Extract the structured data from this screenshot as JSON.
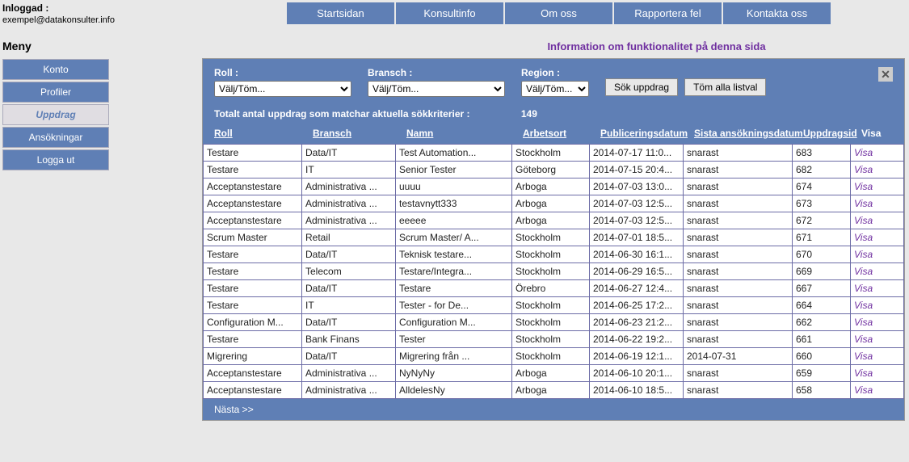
{
  "topNav": [
    "Startsidan",
    "Konsultinfo",
    "Om oss",
    "Rapportera fel",
    "Kontakta oss"
  ],
  "infoLink": "Information om funktionalitet på denna sida",
  "login": {
    "label": "Inloggad :",
    "email": "exempel@datakonsulter.info"
  },
  "menyLabel": "Meny",
  "sideMenu": [
    "Konto",
    "Profiler",
    "Uppdrag",
    "Ansökningar",
    "Logga ut"
  ],
  "sideMenuActive": 2,
  "filters": {
    "roll": {
      "label": "Roll :",
      "value": "Välj/Töm..."
    },
    "bransch": {
      "label": "Bransch :",
      "value": "Välj/Töm..."
    },
    "region": {
      "label": "Region :",
      "value": "Välj/Töm..."
    },
    "searchBtn": "Sök uppdrag",
    "clearBtn": "Töm alla listval"
  },
  "summary": {
    "label": "Totalt antal uppdrag som matchar aktuella sökkriterier :",
    "count": "149"
  },
  "headers": {
    "roll": "Roll",
    "bransch": "Bransch",
    "namn": "Namn",
    "arbetsort": "Arbetsort",
    "pub": "Publiceringsdatum",
    "sista": "Sista ansökningsdatum",
    "id": "Uppdragsid",
    "visa": "Visa"
  },
  "rows": [
    {
      "roll": "Testare",
      "bransch": "Data/IT",
      "namn": "Test Automation...",
      "arbetsort": "Stockholm",
      "pub": "2014-07-17 11:0...",
      "sista": "snarast",
      "id": "683",
      "visa": "Visa"
    },
    {
      "roll": "Testare",
      "bransch": "IT",
      "namn": "Senior Tester",
      "arbetsort": "Göteborg",
      "pub": "2014-07-15 20:4...",
      "sista": "snarast",
      "id": "682",
      "visa": "Visa"
    },
    {
      "roll": "Acceptanstestare",
      "bransch": "Administrativa ...",
      "namn": "uuuu",
      "arbetsort": "Arboga",
      "pub": "2014-07-03 13:0...",
      "sista": "snarast",
      "id": "674",
      "visa": "Visa"
    },
    {
      "roll": "Acceptanstestare",
      "bransch": "Administrativa ...",
      "namn": "testavnytt333",
      "arbetsort": "Arboga",
      "pub": "2014-07-03 12:5...",
      "sista": "snarast",
      "id": "673",
      "visa": "Visa"
    },
    {
      "roll": "Acceptanstestare",
      "bransch": "Administrativa ...",
      "namn": "eeeee",
      "arbetsort": "Arboga",
      "pub": "2014-07-03 12:5...",
      "sista": "snarast",
      "id": "672",
      "visa": "Visa"
    },
    {
      "roll": "Scrum Master",
      "bransch": "Retail",
      "namn": "Scrum Master/ A...",
      "arbetsort": "Stockholm",
      "pub": "2014-07-01 18:5...",
      "sista": "snarast",
      "id": "671",
      "visa": "Visa"
    },
    {
      "roll": "Testare",
      "bransch": "Data/IT",
      "namn": "Teknisk testare...",
      "arbetsort": "Stockholm",
      "pub": "2014-06-30 16:1...",
      "sista": "snarast",
      "id": "670",
      "visa": "Visa"
    },
    {
      "roll": "Testare",
      "bransch": "Telecom",
      "namn": "Testare/Integra...",
      "arbetsort": "Stockholm",
      "pub": "2014-06-29 16:5...",
      "sista": "snarast",
      "id": "669",
      "visa": "Visa"
    },
    {
      "roll": "Testare",
      "bransch": "Data/IT",
      "namn": "Testare",
      "arbetsort": "Örebro",
      "pub": "2014-06-27 12:4...",
      "sista": "snarast",
      "id": "667",
      "visa": "Visa"
    },
    {
      "roll": "Testare",
      "bransch": "IT",
      "namn": "Tester - for De...",
      "arbetsort": "Stockholm",
      "pub": "2014-06-25 17:2...",
      "sista": "snarast",
      "id": "664",
      "visa": "Visa"
    },
    {
      "roll": "Configuration M...",
      "bransch": "Data/IT",
      "namn": "Configuration M...",
      "arbetsort": "Stockholm",
      "pub": "2014-06-23 21:2...",
      "sista": "snarast",
      "id": "662",
      "visa": "Visa"
    },
    {
      "roll": "Testare",
      "bransch": "Bank Finans",
      "namn": "Tester",
      "arbetsort": "Stockholm",
      "pub": "2014-06-22 19:2...",
      "sista": "snarast",
      "id": "661",
      "visa": "Visa"
    },
    {
      "roll": "Migrering",
      "bransch": "Data/IT",
      "namn": "Migrering från ...",
      "arbetsort": "Stockholm",
      "pub": "2014-06-19 12:1...",
      "sista": "2014-07-31",
      "id": "660",
      "visa": "Visa"
    },
    {
      "roll": "Acceptanstestare",
      "bransch": "Administrativa ...",
      "namn": "NyNyNy",
      "arbetsort": "Arboga",
      "pub": "2014-06-10 20:1...",
      "sista": "snarast",
      "id": "659",
      "visa": "Visa"
    },
    {
      "roll": "Acceptanstestare",
      "bransch": "Administrativa ...",
      "namn": "AlldelesNy",
      "arbetsort": "Arboga",
      "pub": "2014-06-10 18:5...",
      "sista": "snarast",
      "id": "658",
      "visa": "Visa"
    }
  ],
  "nextLink": "Nästa >>"
}
